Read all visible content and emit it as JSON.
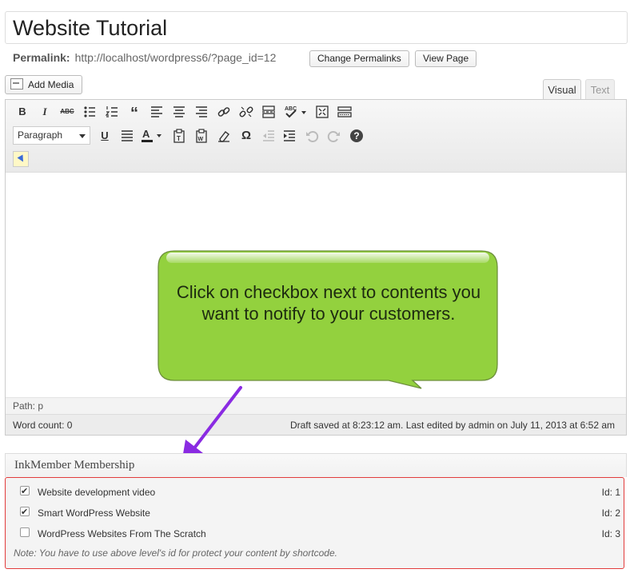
{
  "post": {
    "title": "Website Tutorial",
    "permalink_label": "Permalink:",
    "permalink_url": "http://localhost/wordpress6/?page_id=12",
    "change_permalinks_label": "Change Permalinks",
    "view_page_label": "View Page"
  },
  "media": {
    "add_media_label": "Add Media"
  },
  "editor_tabs": {
    "visual": "Visual",
    "text": "Text"
  },
  "toolbar": {
    "format_select_value": "Paragraph",
    "icons": {
      "bold": "B",
      "italic": "I",
      "strike": "ABC",
      "blockquote": "“",
      "underline": "U",
      "text_color": "A",
      "special_char": "Ω",
      "help": "?"
    }
  },
  "status": {
    "path": "Path: p",
    "word_count": "Word count: 0",
    "draft_info": "Draft saved at 8:23:12 am. Last edited by admin on July 11, 2013 at 6:52 am"
  },
  "callout": {
    "text": "Click on checkbox next to contents you want to notify to your customers.",
    "fill_color": "#93d13e",
    "arrow_color": "#8a2be2"
  },
  "membership": {
    "title": "InkMember Membership",
    "levels": [
      {
        "name": "Website development video",
        "id_label": "Id: 1",
        "checked": true
      },
      {
        "name": "Smart WordPress Website",
        "id_label": "Id: 2",
        "checked": true
      },
      {
        "name": "WordPress Websites From The Scratch",
        "id_label": "Id: 3",
        "checked": false
      }
    ],
    "note": "Note: You have to use above level's id for protect your content by shortcode."
  }
}
